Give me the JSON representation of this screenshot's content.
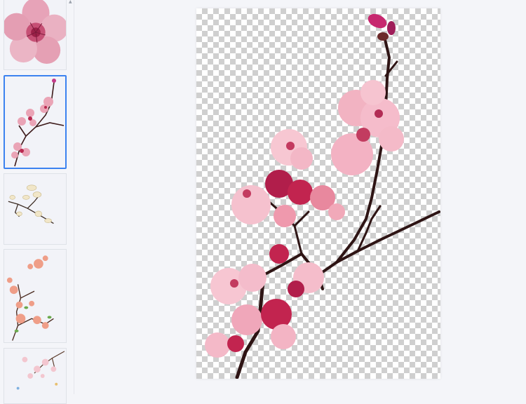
{
  "app": {
    "accent_color": "#3c82f0",
    "selected_index": 1
  },
  "sidebar": {
    "scroll_icon": "chevron-up-icon",
    "items": [
      {
        "subject": "pink-blossom-closeup-icon",
        "selected": false
      },
      {
        "subject": "pink-blossom-branch-icon",
        "selected": true
      },
      {
        "subject": "white-magnolia-branch-icon",
        "selected": false
      },
      {
        "subject": "peach-blossom-branch-icon",
        "selected": false
      },
      {
        "subject": "cherry-blossom-sprig-icon",
        "selected": false
      }
    ]
  },
  "preview": {
    "subject": "pink-blossom-branch-icon",
    "background": "transparency-checkerboard"
  }
}
